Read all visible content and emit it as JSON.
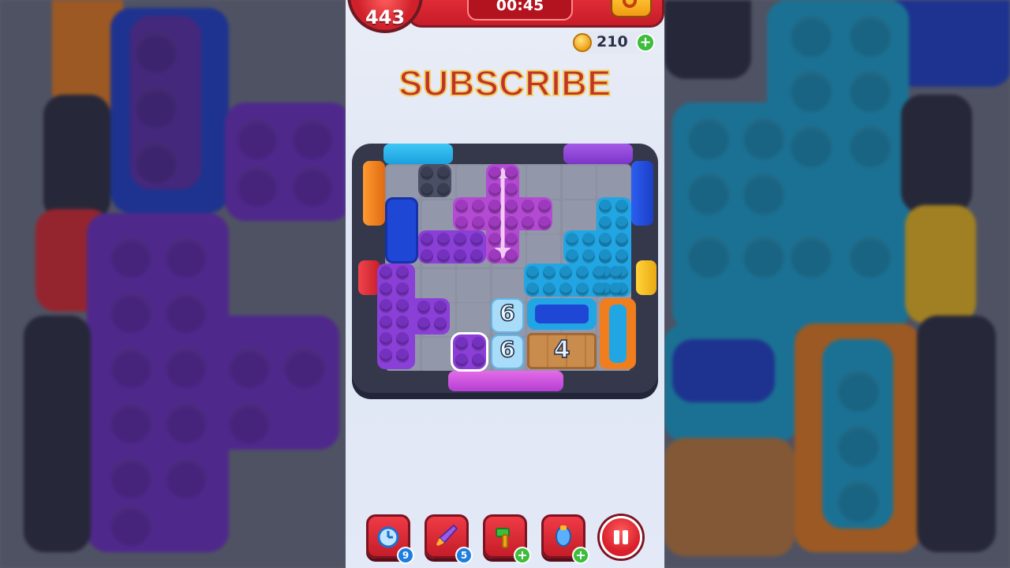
{
  "header": {
    "level": "443",
    "timer": "00:45",
    "settings_icon": "gear-icon"
  },
  "coins": {
    "count": "210",
    "icon": "coin-icon",
    "add_icon": "plus-icon"
  },
  "overlay_text": "SUBSCRIBE",
  "board": {
    "number_tiles": [
      "6",
      "6"
    ],
    "wood_tile_number": "4",
    "colors": {
      "purple": "#8a3fd6",
      "magenta": "#b24bd1",
      "cyan": "#22a6e3",
      "blue": "#1f47d6",
      "orange": "#f07d1e",
      "slate": "#4b4f66"
    }
  },
  "toolbar": {
    "tools": [
      {
        "icon": "alarm-clock-icon",
        "badge": "9"
      },
      {
        "icon": "rocket-icon",
        "badge": "5"
      },
      {
        "icon": "hammer-icon",
        "badge": "+"
      },
      {
        "icon": "vacuum-icon",
        "badge": "+"
      }
    ],
    "pause_icon": "pause-icon"
  }
}
